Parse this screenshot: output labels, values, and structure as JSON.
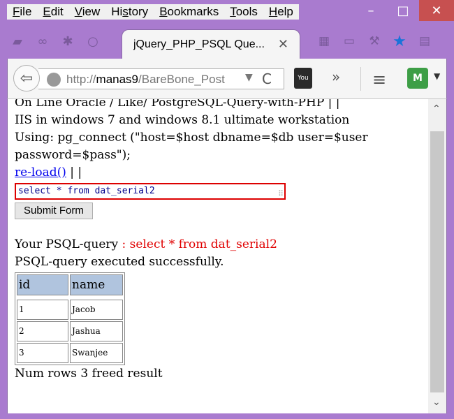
{
  "menubar": {
    "items": [
      "File",
      "Edit",
      "View",
      "History",
      "Bookmarks",
      "Tools",
      "Help"
    ],
    "accel": [
      "F",
      "E",
      "V",
      "s",
      "B",
      "T",
      "H"
    ]
  },
  "window": {
    "minimize": "–",
    "maximize": "□",
    "close": "✕"
  },
  "tab": {
    "title": "jQuery_PHP_PSQL Que...",
    "close": "✕"
  },
  "nav": {
    "url_prefix": "http://",
    "url_host": "manas9",
    "url_path": "/BareBone_Post",
    "reload": "C",
    "overflow": "»",
    "menu": "≡"
  },
  "page": {
    "line1": "On Line Oracle / Like/ PostgreSQL-Query-with-PHP | |",
    "line2": "IIS in windows 7 and windows 8.1 ultimate workstation",
    "line3": "Using: pg_connect (\"host=$host dbname=$db user=$user",
    "line4": "password=$pass\");",
    "reload_link": "re-load()",
    "reload_suffix": " | |",
    "query_value": "select * from dat_serial2",
    "submit_label": "Submit Form",
    "your_query_label": "Your PSQL-query ",
    "your_query_value": ": select * from dat_serial2",
    "executed": "PSQL-query executed successfully.",
    "table": {
      "headers": [
        "id",
        "name"
      ],
      "rows": [
        [
          "1",
          "Jacob"
        ],
        [
          "2",
          "Jashua"
        ],
        [
          "3",
          "Swanjee"
        ]
      ]
    },
    "footer": "Num rows 3 freed result"
  },
  "colors": {
    "chrome": "#a97bcf",
    "link": "#0000ee",
    "highlight": "#e00000",
    "table_header": "#b0c4de",
    "star": "#1a73d9"
  }
}
